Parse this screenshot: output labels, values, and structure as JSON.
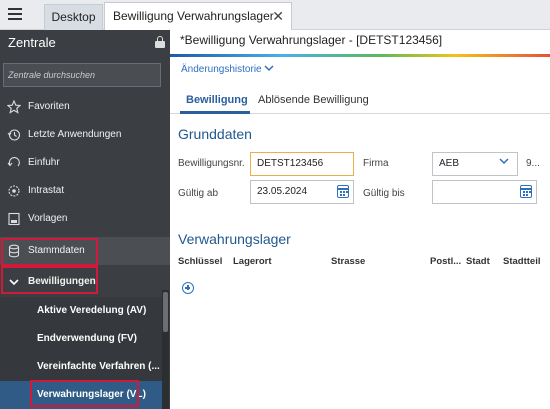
{
  "tabs": {
    "desktop": "Desktop",
    "document": "Bewilligung Verwahrungslager",
    "close": "✕"
  },
  "sidebar": {
    "title": "Zentrale",
    "search_placeholder": "Zentrale durchsuchen",
    "items": [
      {
        "label": "Favoriten",
        "icon": "star-icon"
      },
      {
        "label": "Letzte Anwendungen",
        "icon": "history-icon"
      },
      {
        "label": "Einfuhr",
        "icon": "import-icon"
      },
      {
        "label": "Intrastat",
        "icon": "intrastat-icon"
      },
      {
        "label": "Vorlagen",
        "icon": "template-icon"
      },
      {
        "label": "Stammdaten",
        "icon": "database-icon"
      },
      {
        "label": "Bewilligungen",
        "icon": "chevron-down-icon"
      }
    ],
    "subitems": [
      {
        "label": "Aktive Veredelung (AV)"
      },
      {
        "label": "Endverwendung (FV)"
      },
      {
        "label": "Vereinfachte Verfahren (..."
      },
      {
        "label": "Verwahrungslager (VL)"
      }
    ]
  },
  "main": {
    "title": "*Bewilligung Verwahrungslager - [DETST123456]",
    "history": "Änderungshistorie",
    "tabs": [
      "Bewilligung",
      "Ablösende Bewilligung"
    ],
    "grunddaten": {
      "heading": "Grunddaten",
      "bewilligungsnr_label": "Bewilligungsnr.",
      "bewilligungsnr_value": "DETST123456",
      "firma_label": "Firma",
      "firma_value": "AEB",
      "firma_extra": "9...",
      "gueltig_ab_label": "Gültig ab",
      "gueltig_ab_value": "23.05.2024",
      "gueltig_bis_label": "Gültig bis",
      "gueltig_bis_value": ""
    },
    "verwahrungslager": {
      "heading": "Verwahrungslager",
      "columns": [
        "Schlüssel",
        "Lagerort",
        "Strasse",
        "Postl...",
        "Stadt",
        "Stadtteil"
      ]
    }
  },
  "colors": {
    "sidebar": "#3b3e42",
    "accent": "#2f6fc0",
    "active_item": "#2f5b86",
    "highlight_box": "#d11a3a"
  }
}
